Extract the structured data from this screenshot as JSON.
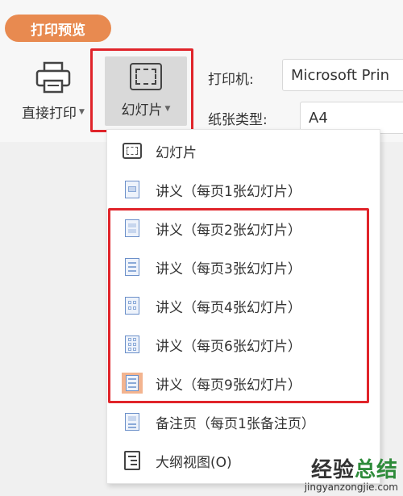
{
  "ribbon": {
    "tab_label": "打印预览",
    "direct_print_label": "直接打印",
    "slide_label": "幻灯片",
    "printer_label": "打印机:",
    "printer_value": "Microsoft Prin",
    "paper_label": "纸张类型:",
    "paper_value": "A4"
  },
  "menu": {
    "items": [
      {
        "label": "幻灯片",
        "icon": "slide-icon"
      },
      {
        "label": "讲义（每页1张幻灯片）",
        "icon": "handout-1-icon"
      },
      {
        "label": "讲义（每页2张幻灯片）",
        "icon": "handout-2-icon"
      },
      {
        "label": "讲义（每页3张幻灯片）",
        "icon": "handout-3-icon"
      },
      {
        "label": "讲义（每页4张幻灯片）",
        "icon": "handout-4-icon"
      },
      {
        "label": "讲义（每页6张幻灯片）",
        "icon": "handout-6-icon"
      },
      {
        "label": "讲义（每页9张幻灯片）",
        "icon": "handout-9-icon"
      },
      {
        "label": "备注页（每页1张备注页）",
        "icon": "notes-page-icon"
      },
      {
        "label": "大纲视图(O)",
        "icon": "outline-icon"
      }
    ]
  },
  "watermark": {
    "text_black": "经验",
    "text_green": "总结",
    "url": "jingyanzongjie.com"
  },
  "colors": {
    "accent": "#e88a50",
    "highlight_border": "#e0242a",
    "selected_icon_bg": "#f3b48f"
  }
}
